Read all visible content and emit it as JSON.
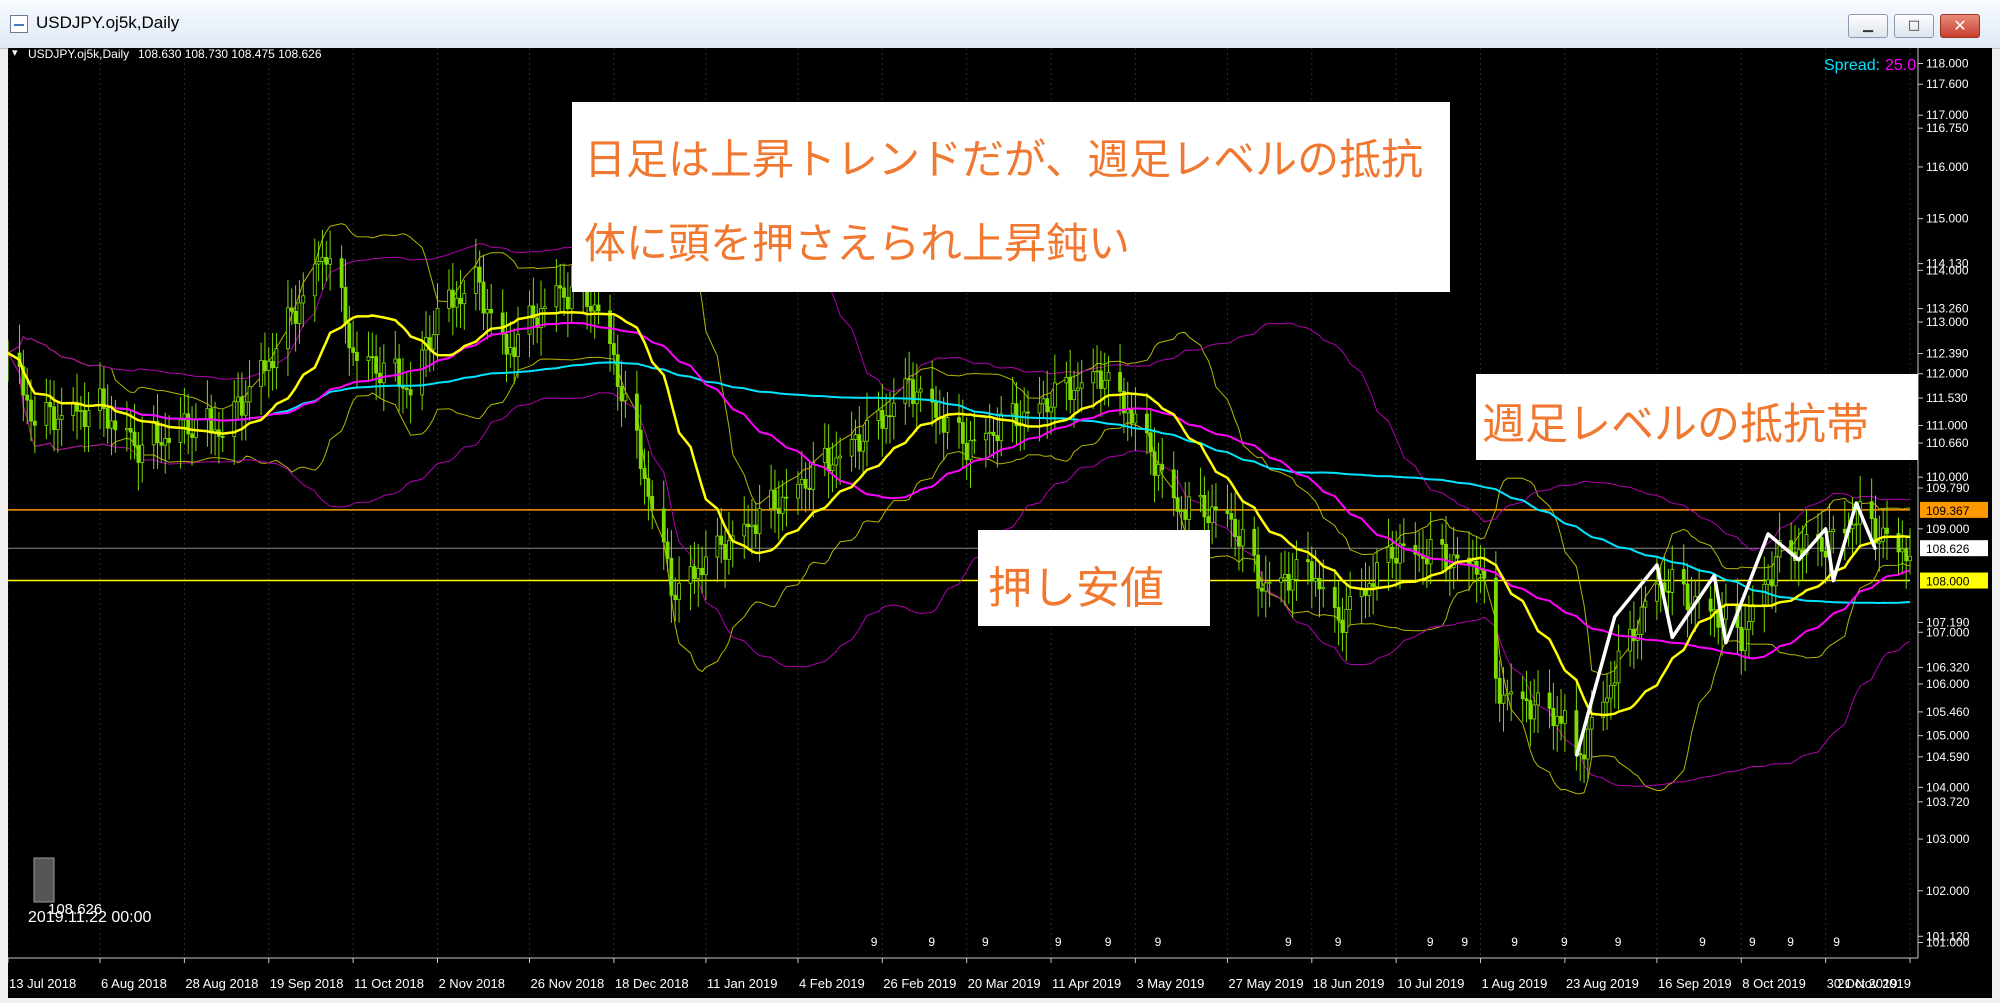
{
  "window": {
    "title": "USDJPY.oj5k,Daily",
    "minimize": "▁",
    "maximize": "□",
    "close": "✕"
  },
  "chart_header": {
    "symbol": "USDJPY.oj5k,Daily",
    "ohlc": "108.630 108.730 108.475 108.626"
  },
  "spread": {
    "label": "Spread:",
    "value": "25.0"
  },
  "crosshair": {
    "price": "108.626",
    "datetime": "2019.11.22 00:00"
  },
  "callouts": {
    "top_line1": "日足は上昇トレンドだが、週足レベルの抵抗",
    "top_line2": "体に頭を押さえられ上昇鈍い",
    "support": "押し安値",
    "resistance": "週足レベルの抵抗帯"
  },
  "colors": {
    "ma_fast": "#ffff00",
    "ma_mid": "#ff00ff",
    "ma_slow": "#00e5ff",
    "band": "#b5b500",
    "band_outer": "#b000b0",
    "candle": "#7ddc00",
    "level_res": "#ff9900",
    "level_sup": "#ffff00",
    "annotation": "#ffffff",
    "callout_text": "#f07830"
  },
  "chart_data": {
    "type": "line",
    "subtype": "candlestick",
    "symbol": "USDJPY.oj5k",
    "timeframe": "Daily",
    "ylim": [
      100.7,
      118.3
    ],
    "y_ticks": [
      "118.000",
      "117.600",
      "117.000",
      "116.750",
      "116.000",
      "115.000",
      "114.130",
      "114.000",
      "113.260",
      "113.000",
      "112.390",
      "112.000",
      "111.530",
      "111.000",
      "110.660",
      "110.000",
      "109.790",
      "109.000",
      "107.190",
      "107.000",
      "106.320",
      "106.000",
      "105.460",
      "105.000",
      "104.590",
      "104.000",
      "103.720",
      "103.000",
      "102.000",
      "101.120",
      "101.000"
    ],
    "x_ticks": [
      "13 Jul 2018",
      "6 Aug 2018",
      "28 Aug 2018",
      "19 Sep 2018",
      "11 Oct 2018",
      "2 Nov 2018",
      "26 Nov 2018",
      "18 Dec 2018",
      "11 Jan 2019",
      "4 Feb 2019",
      "26 Feb 2019",
      "20 Mar 2019",
      "11 Apr 2019",
      "3 May 2019",
      "27 May 2019",
      "18 Jun 2019",
      "10 Jul 2019",
      "1 Aug 2019",
      "23 Aug 2019",
      "16 Sep 2019",
      "8 Oct 2019",
      "30 Oct 2019",
      "21 Nov 2019"
    ],
    "levels": [
      {
        "price": 109.367,
        "label": "109.367"
      },
      {
        "price": 108.626,
        "label": "108.626"
      },
      {
        "price": 108.0,
        "label": "108.000"
      }
    ],
    "price_path": [
      {
        "date": "13 Jul 2018",
        "price": 112.4
      },
      {
        "date": "20 Jul 2018",
        "price": 111.2
      },
      {
        "date": "6 Aug 2018",
        "price": 111.4
      },
      {
        "date": "17 Aug 2018",
        "price": 110.6
      },
      {
        "date": "28 Aug 2018",
        "price": 111.1
      },
      {
        "date": "7 Sep 2018",
        "price": 111.0
      },
      {
        "date": "19 Sep 2018",
        "price": 112.3
      },
      {
        "date": "4 Oct 2018",
        "price": 114.5
      },
      {
        "date": "11 Oct 2018",
        "price": 112.5
      },
      {
        "date": "26 Oct 2018",
        "price": 111.8
      },
      {
        "date": "2 Nov 2018",
        "price": 113.2
      },
      {
        "date": "12 Nov 2018",
        "price": 113.9
      },
      {
        "date": "20 Nov 2018",
        "price": 112.5
      },
      {
        "date": "3 Dec 2018",
        "price": 113.7
      },
      {
        "date": "14 Dec 2018",
        "price": 113.4
      },
      {
        "date": "25 Dec 2018",
        "price": 110.4
      },
      {
        "date": "3 Jan 2019",
        "price": 107.8
      },
      {
        "date": "11 Jan 2019",
        "price": 108.5
      },
      {
        "date": "4 Feb 2019",
        "price": 109.9
      },
      {
        "date": "26 Feb 2019",
        "price": 111.2
      },
      {
        "date": "5 Mar 2019",
        "price": 111.9
      },
      {
        "date": "20 Mar 2019",
        "price": 110.7
      },
      {
        "date": "11 Apr 2019",
        "price": 111.6
      },
      {
        "date": "24 Apr 2019",
        "price": 112.1
      },
      {
        "date": "3 May 2019",
        "price": 111.2
      },
      {
        "date": "14 May 2019",
        "price": 109.5
      },
      {
        "date": "27 May 2019",
        "price": 109.4
      },
      {
        "date": "5 Jun 2019",
        "price": 108.0
      },
      {
        "date": "18 Jun 2019",
        "price": 108.3
      },
      {
        "date": "25 Jun 2019",
        "price": 107.3
      },
      {
        "date": "10 Jul 2019",
        "price": 108.7
      },
      {
        "date": "1 Aug 2019",
        "price": 108.4
      },
      {
        "date": "5 Aug 2019",
        "price": 106.0
      },
      {
        "date": "23 Aug 2019",
        "price": 105.4
      },
      {
        "date": "26 Aug 2019",
        "price": 104.6
      },
      {
        "date": "16 Sep 2019",
        "price": 108.1
      },
      {
        "date": "1 Oct 2019",
        "price": 107.5
      },
      {
        "date": "8 Oct 2019",
        "price": 107.0
      },
      {
        "date": "18 Oct 2019",
        "price": 108.6
      },
      {
        "date": "30 Oct 2019",
        "price": 108.8
      },
      {
        "date": "7 Nov 2019",
        "price": 109.3
      },
      {
        "date": "21 Nov 2019",
        "price": 108.6
      }
    ]
  }
}
